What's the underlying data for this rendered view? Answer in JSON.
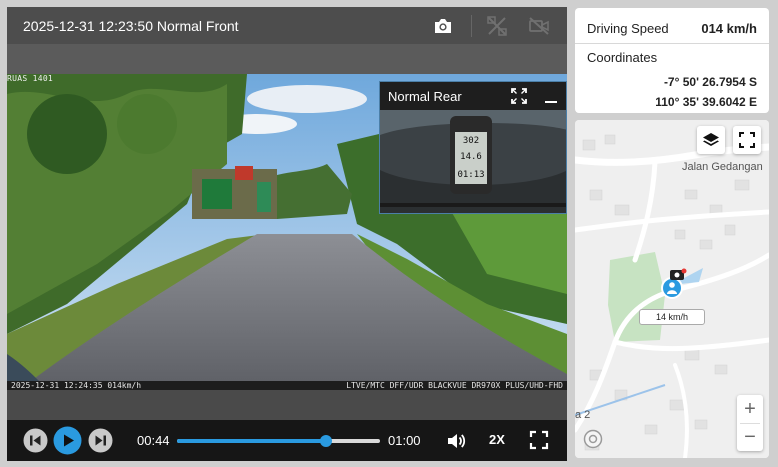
{
  "video": {
    "title": "2025-12-31 12:23:50 Normal Front",
    "osd_top": "RUAS 1401",
    "osd_bottom_left": "2025-12-31 12:24:35 014km/h",
    "osd_bottom_right": "LTVE/MTC DFF/UDR BLACKVUE DR970X PLUS/UHD-FHD"
  },
  "pip": {
    "title": "Normal Rear",
    "gps_lines": [
      "302",
      "14.6",
      "01:13"
    ]
  },
  "controls": {
    "current_time": "00:44",
    "total_time": "01:00",
    "progress": 0.733,
    "speed": "2X"
  },
  "info": {
    "speed_label": "Driving Speed",
    "speed_value": "014 km/h",
    "coords_label": "Coordinates",
    "latitude": "-7° 50' 26.7954 S",
    "longitude": "110° 35' 39.6042 E"
  },
  "map": {
    "street": "Jalan Gedangan",
    "area": "a 2",
    "marker_speed": "14 km/h",
    "zoom_in": "+",
    "zoom_out": "−"
  },
  "colors": {
    "accent": "#2a9ae0",
    "topbar": "#4d4d4d",
    "controls_bg": "#161616"
  }
}
